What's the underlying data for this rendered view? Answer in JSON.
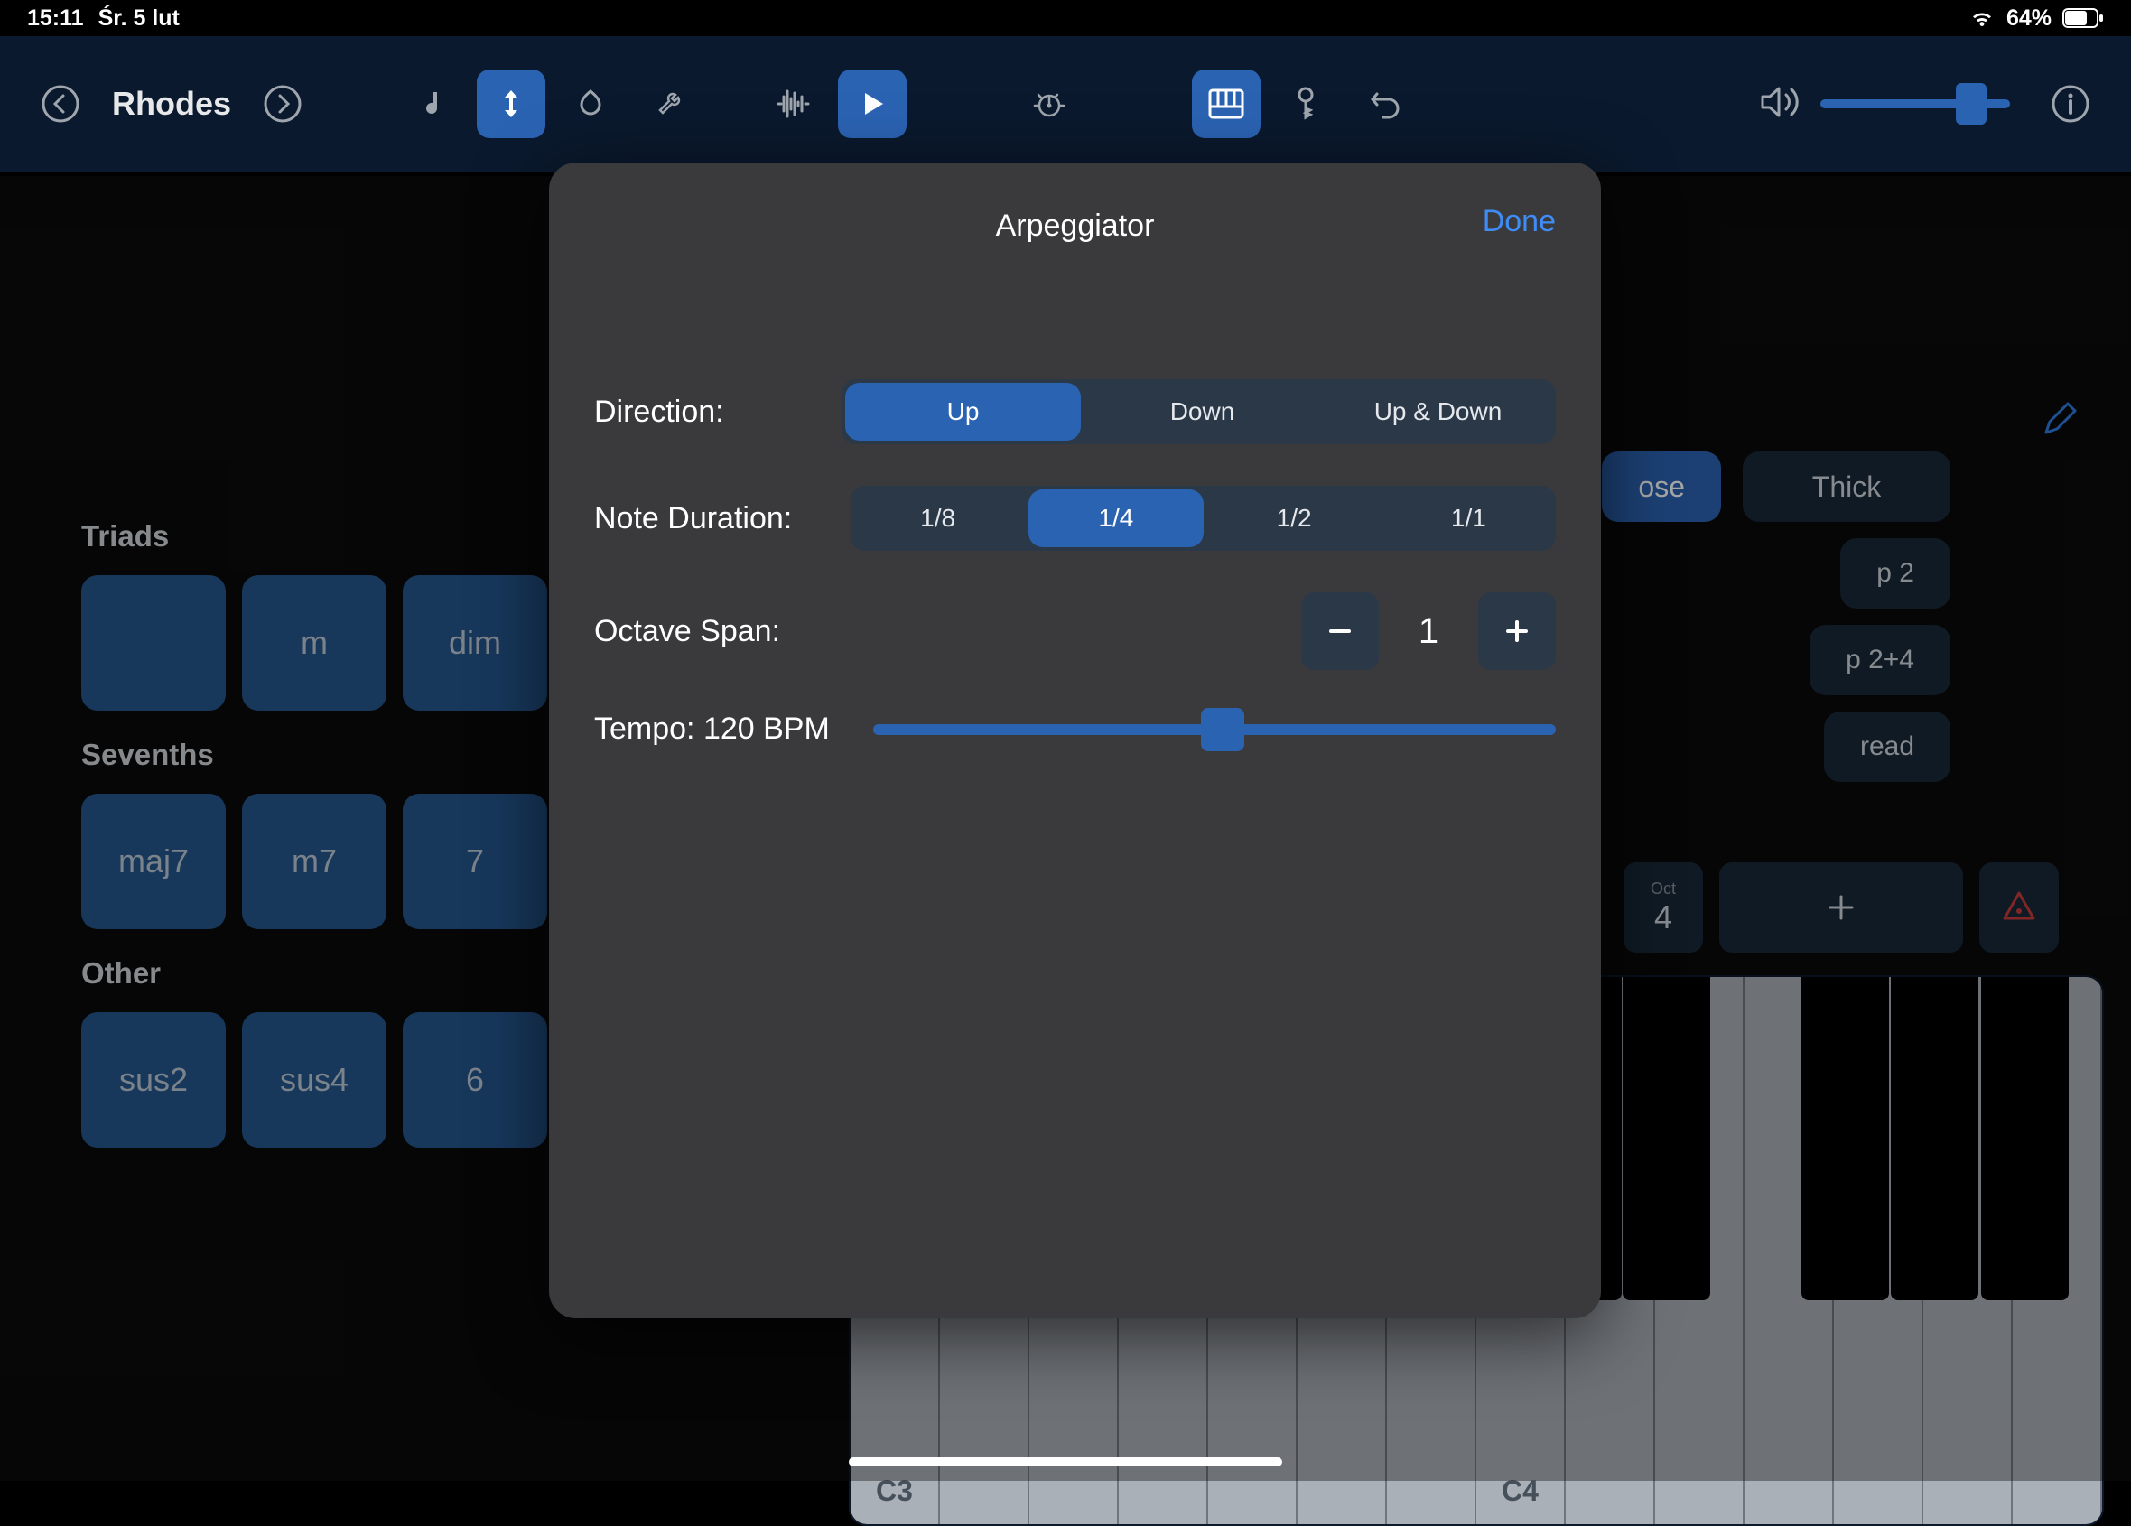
{
  "status": {
    "time": "15:11",
    "date": "Śr. 5 lut",
    "battery": "64%"
  },
  "toolbar": {
    "instrument": "Rhodes"
  },
  "chords": {
    "triads_label": "Triads",
    "triads": [
      "",
      "m",
      "dim"
    ],
    "sevenths_label": "Sevenths",
    "sevenths": [
      "maj7",
      "m7",
      "7"
    ],
    "other_label": "Other",
    "other": [
      "sus2",
      "sus4",
      "6"
    ]
  },
  "right": {
    "voicing": [
      "ose",
      "Thick"
    ],
    "drops": [
      "p 2",
      "p 2+4",
      "read"
    ],
    "oct_label": "Oct",
    "oct_value": "4"
  },
  "piano": {
    "c3": "C3",
    "c4": "C4"
  },
  "modal": {
    "title": "Arpeggiator",
    "done": "Done",
    "direction_label": "Direction:",
    "direction_opts": [
      "Up",
      "Down",
      "Up & Down"
    ],
    "direction_selected": 0,
    "duration_label": "Note Duration:",
    "duration_opts": [
      "1/8",
      "1/4",
      "1/2",
      "1/1"
    ],
    "duration_selected": 1,
    "octave_label": "Octave Span:",
    "octave_value": "1",
    "tempo_label": "Tempo: 120 BPM",
    "tempo_fraction": 0.48
  }
}
